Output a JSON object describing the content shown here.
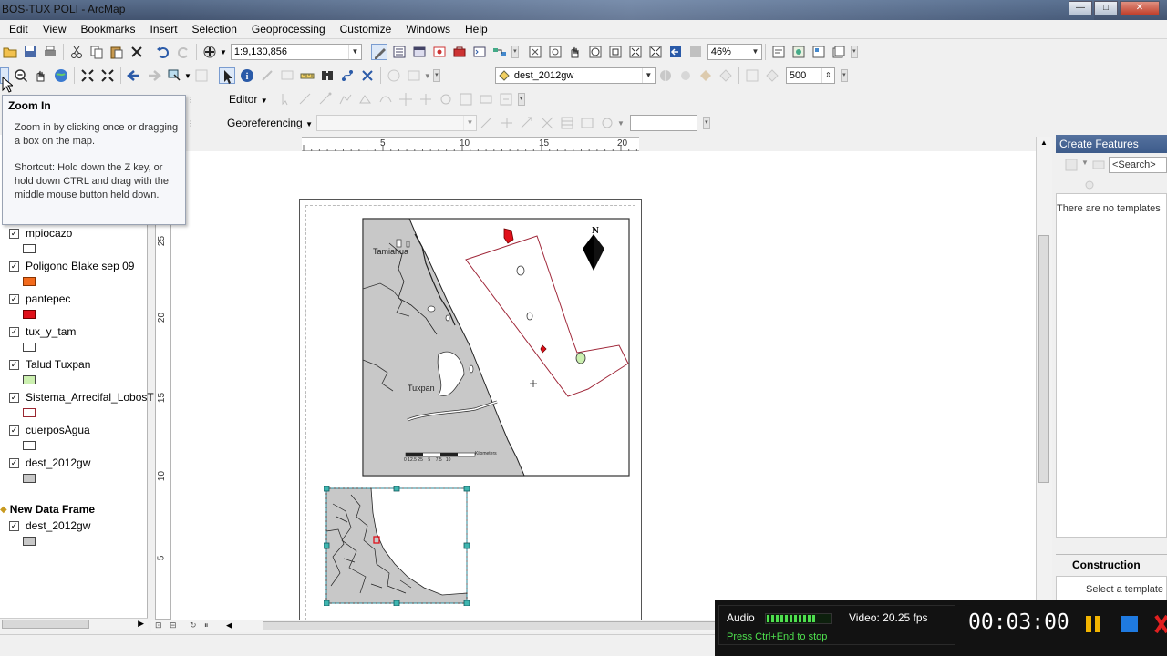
{
  "window": {
    "title": "BOS-TUX POLI - ArcMap",
    "minimize": "—",
    "maximize": "□",
    "close": "✕"
  },
  "menubar": {
    "items": [
      "Edit",
      "View",
      "Bookmarks",
      "Insert",
      "Selection",
      "Geoprocessing",
      "Customize",
      "Windows",
      "Help"
    ]
  },
  "toolbar": {
    "scale": "1:9,130,856",
    "zoom_percent": "46%",
    "target_layer": "dest_2012gw",
    "sketch_value": "500",
    "editor_label": "Editor",
    "georef_label": "Georeferencing",
    "georef_layer": "",
    "georef_input": ""
  },
  "tooltip": {
    "title": "Zoom In",
    "body": "Zoom in by clicking once or dragging a box on the map.",
    "shortcut": "Shortcut: Hold down the Z key, or hold down CTRL and drag with the middle mouse button held down."
  },
  "toc": {
    "layers": [
      {
        "name": "mpiocazo",
        "checked": true,
        "swatch": "#ffffff",
        "outline": "#444444"
      },
      {
        "name": "Poligono Blake sep 09",
        "checked": true,
        "swatch": "#f26a1c",
        "outline": "#883300"
      },
      {
        "name": "pantepec",
        "checked": true,
        "swatch": "#e0101a",
        "outline": "#700000"
      },
      {
        "name": "tux_y_tam",
        "checked": true,
        "swatch": "#ffffff",
        "outline": "#444444"
      },
      {
        "name": "Talud Tuxpan",
        "checked": true,
        "swatch": "#ccf0b0",
        "outline": "#444444"
      },
      {
        "name": "Sistema_Arrecifal_LobosT",
        "checked": true,
        "swatch": "#ffffff",
        "outline": "#9a2630"
      },
      {
        "name": "cuerposAgua",
        "checked": true,
        "swatch": "#ffffff",
        "outline": "#444444"
      },
      {
        "name": "dest_2012gw",
        "checked": true,
        "swatch": "#c8c8c8",
        "outline": "#444444"
      }
    ],
    "new_data_frame": {
      "name": "New Data Frame",
      "layers": [
        {
          "name": "dest_2012gw",
          "checked": true,
          "swatch": "#c8c8c8",
          "outline": "#444444"
        }
      ]
    }
  },
  "rulers": {
    "horizontal": [
      "5",
      "10",
      "15",
      "20"
    ],
    "vertical": [
      "25",
      "20",
      "15",
      "10",
      "5"
    ]
  },
  "map": {
    "labels": {
      "north": "N",
      "tamiahua": "Tamiahua",
      "tuxpan": "Tuxpan",
      "scale_unit": "Kilometers"
    },
    "scale_ticks": "0 12.5 25    5    7.5   10",
    "colors": {
      "land": "#c8c8c8",
      "polygon_outline": "#a0283a",
      "red_feature": "#e0101a",
      "green_feature": "#ccf0b0"
    }
  },
  "create_features": {
    "title": "Create Features",
    "search_placeholder": "<Search>",
    "empty_message": "There are no templates",
    "construction_title": "Construction Tools",
    "construction_hint": "Select a template"
  },
  "recorder": {
    "audio_label": "Audio",
    "audio_level": 0.75,
    "fps": "Video: 20.25 fps",
    "hint": "Press Ctrl+End to stop",
    "time": "00:03:00"
  }
}
